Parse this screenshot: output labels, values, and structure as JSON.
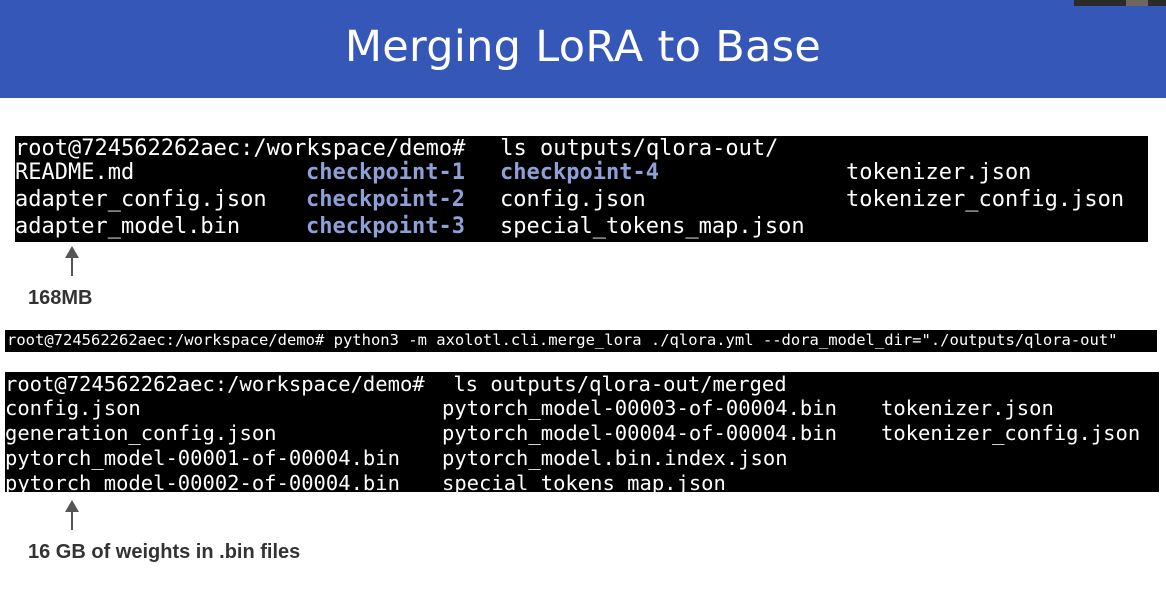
{
  "slide": {
    "title": "Merging LoRA to Base"
  },
  "terminal1": {
    "prompt": "root@724562262aec:/workspace/demo#",
    "command": " ls outputs/qlora-out/",
    "rows": [
      [
        "README.md",
        "checkpoint-1",
        "checkpoint-4",
        "tokenizer.json"
      ],
      [
        "adapter_config.json",
        "checkpoint-2",
        "config.json",
        "tokenizer_config.json"
      ],
      [
        "adapter_model.bin",
        "checkpoint-3",
        "special_tokens_map.json",
        ""
      ]
    ]
  },
  "terminal2": {
    "line": "root@724562262aec:/workspace/demo# python3 -m axolotl.cli.merge_lora ./qlora.yml --dora_model_dir=\"./outputs/qlora-out\""
  },
  "terminal3": {
    "prompt": "root@724562262aec:/workspace/demo#",
    "command": " ls outputs/qlora-out/merged",
    "rows": [
      [
        "config.json",
        "pytorch_model-00003-of-00004.bin",
        "tokenizer.json"
      ],
      [
        "generation_config.json",
        "pytorch_model-00004-of-00004.bin",
        "tokenizer_config.json"
      ],
      [
        "pytorch_model-00001-of-00004.bin",
        "pytorch_model.bin.index.json",
        ""
      ],
      [
        "pytorch_model-00002-of-00004.bin",
        "special_tokens_map.json",
        ""
      ]
    ]
  },
  "annotations": {
    "adapter_size": "168MB",
    "weights_size": "16 GB of weights in .bin files"
  },
  "colors": {
    "header": "#3557b7",
    "directory": "#8fa0d8",
    "terminal_bg": "#000000"
  }
}
